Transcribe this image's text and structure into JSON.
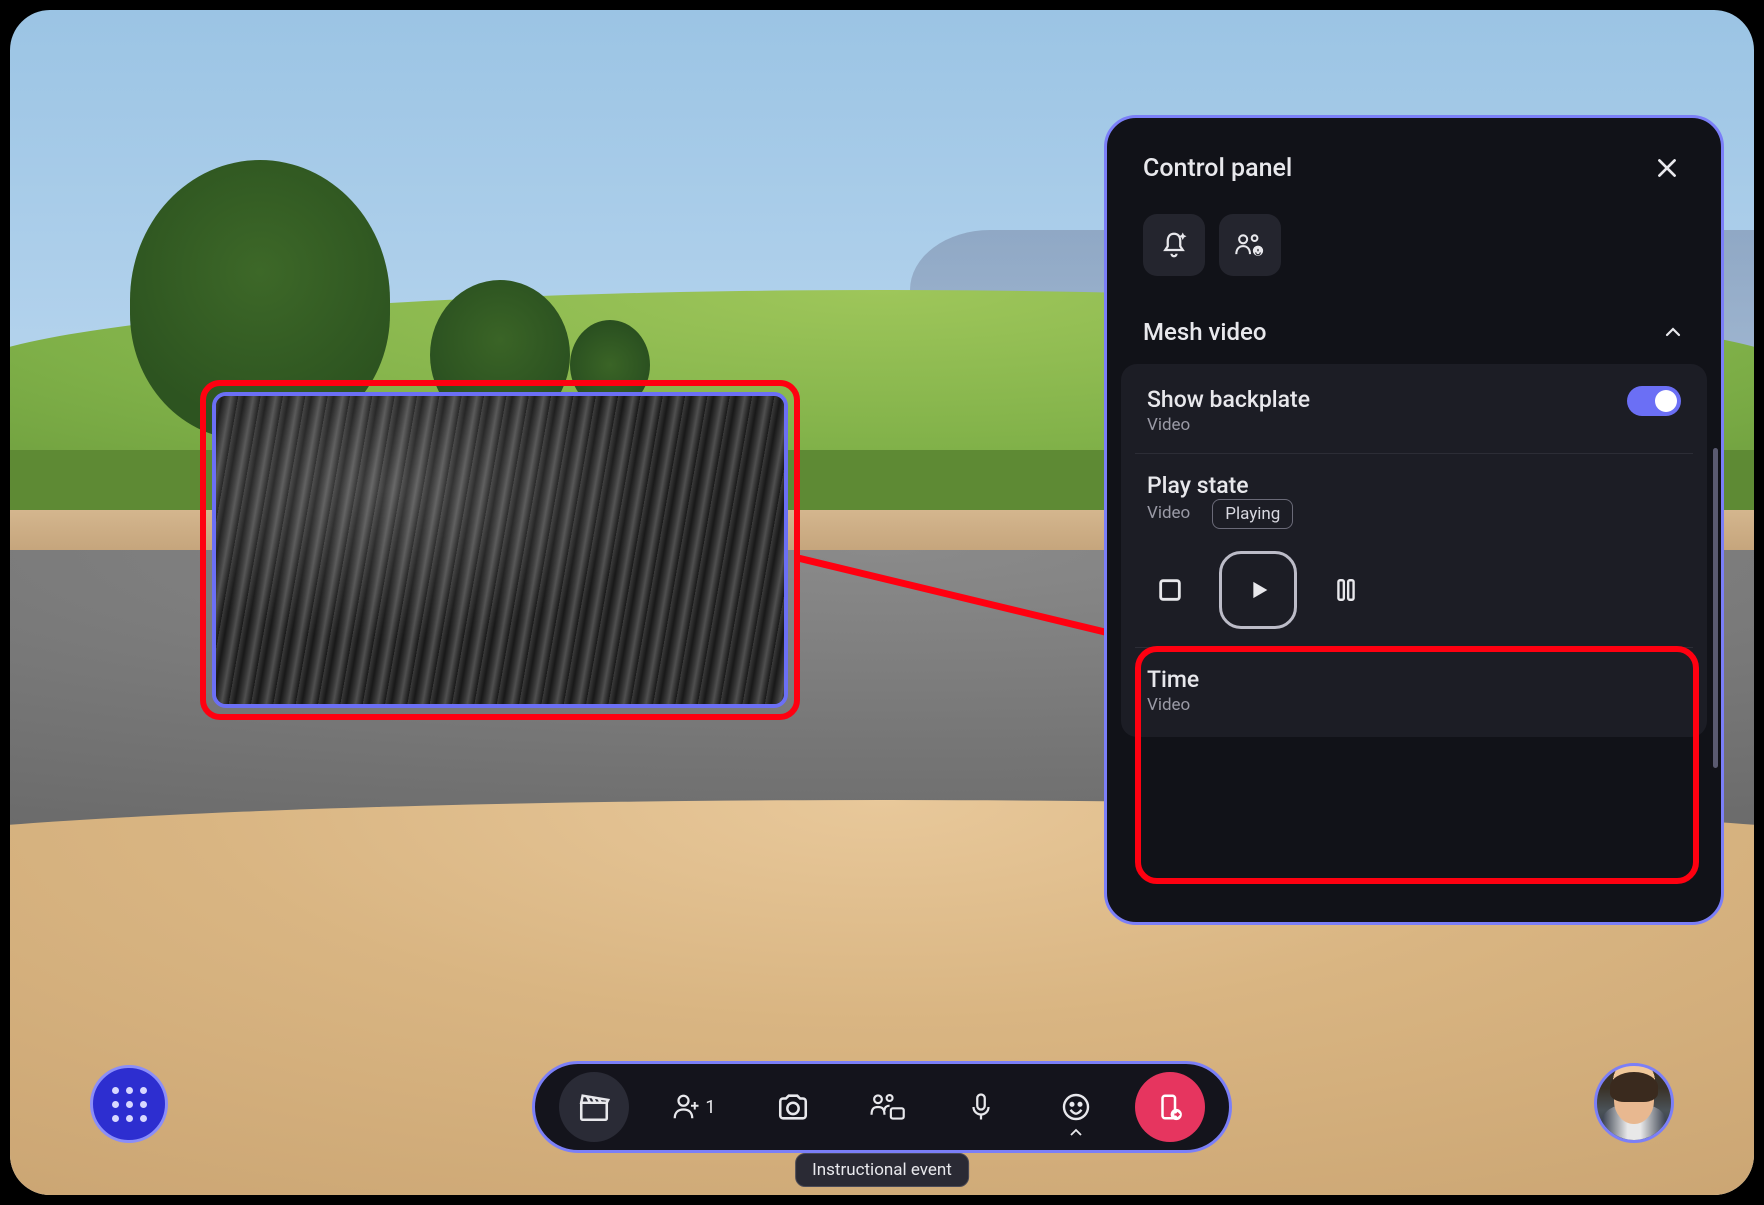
{
  "panel": {
    "title": "Control panel",
    "section_title": "Mesh video",
    "backplate": {
      "label": "Show backplate",
      "sub": "Video",
      "enabled": true
    },
    "playstate": {
      "label": "Play state",
      "sub": "Video",
      "badge": "Playing"
    },
    "time": {
      "label": "Time",
      "sub": "Video"
    }
  },
  "toolbar": {
    "people_count": "1",
    "tooltip": "Instructional event"
  },
  "colors": {
    "accent": "#7b7ff8",
    "highlight": "#ff0010",
    "end_call": "#e6355f"
  }
}
